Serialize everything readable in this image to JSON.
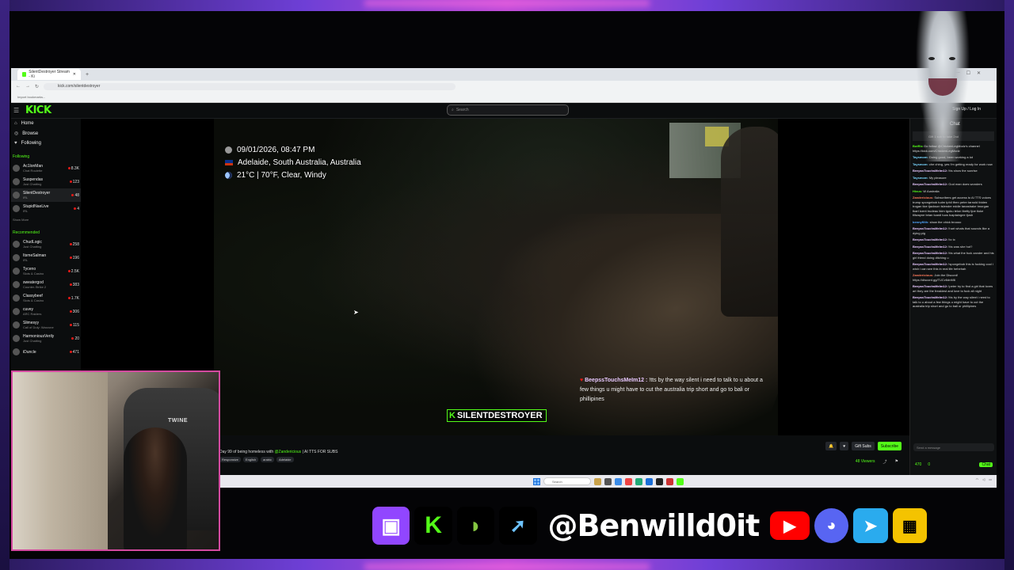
{
  "browser": {
    "tab_title": "SilentDestroyer Stream - Ki",
    "url": "kick.com/silentdestroyer",
    "bookmarks": "Import bookmarks..."
  },
  "kick": {
    "logo": "KICK",
    "search_placeholder": "Search",
    "login": "Sign Up / Log In",
    "nav": [
      {
        "label": "Home",
        "icon": "home-icon"
      },
      {
        "label": "Browse",
        "icon": "compass-icon"
      },
      {
        "label": "Following",
        "icon": "heart-icon"
      }
    ],
    "following_header": "Following",
    "following": [
      {
        "name": "Ac1lonMan",
        "sub": "Chat Roulette",
        "viewers": "8.3K"
      },
      {
        "name": "Suspendas",
        "sub": "Just Chatting",
        "viewers": "123"
      },
      {
        "name": "SilentDestroyer",
        "sub": "IRL",
        "viewers": "48"
      },
      {
        "name": "StupidNaeLive",
        "sub": "IRL",
        "viewers": "4"
      }
    ],
    "show_more": "Show More",
    "recommended_header": "Recommended",
    "recommended": [
      {
        "name": "ChudLogic",
        "sub": "Just Chatting",
        "viewers": "258"
      },
      {
        "name": "ItsmeSalman",
        "sub": "IRL",
        "viewers": "196"
      },
      {
        "name": "Tyceno",
        "sub": "Slots & Casino",
        "viewers": "2.5K"
      },
      {
        "name": "sweatergod",
        "sub": "Counter-Strike 2",
        "viewers": "383"
      },
      {
        "name": "Classybeef",
        "sub": "Slots & Casino",
        "viewers": "1.7K"
      },
      {
        "name": "cuvey",
        "sub": "ARC Raiders",
        "viewers": "306"
      },
      {
        "name": "Slimesyy",
        "sub": "Call of Duty: Warzone",
        "viewers": "115"
      },
      {
        "name": "HarmoniousVerily",
        "sub": "Just Chatting",
        "viewers": "20"
      },
      {
        "name": "iDuncle",
        "sub": "",
        "viewers": "471"
      }
    ]
  },
  "overlay": {
    "datetime": "09/01/2026, 08:47 PM",
    "location": "Adelaide, South Australia, Australia",
    "weather": "21°C | 70°F, Clear, Windy"
  },
  "tts": {
    "user": "BeepssTouchsMeIm12 :",
    "message": "!tts by the way silent i need to talk to u about a few things u might have to cut the australia trip short and go to bali or phillipines"
  },
  "watermark": "SILENTDESTROYER",
  "stream": {
    "title_prefix": "Day 99 of being homeless with",
    "title_mention": "@Zandericious",
    "title_suffix": "| AI TTS FOR SUBS",
    "tags": [
      "Responsive",
      "English",
      "arabic",
      "Adelaide"
    ],
    "gift_subs": "Gift Subs",
    "subscribe": "Subscribe",
    "viewers": "48 Viewers"
  },
  "chat": {
    "header": "Chat",
    "pinned": "Gift 1 sub to take 2nd",
    "messages": [
      {
        "user": "BotRix",
        "text": "Go follow @ChickenLegModz's channel https://kick.com/ChickenLegModz",
        "color": "#53fc18"
      },
      {
        "user": "Taysmom:",
        "text": "Doing good, been working a lot",
        "color": "#7ad7ff"
      },
      {
        "user": "Taysmom:",
        "text": "che ching, yes I'm getting ready for work now",
        "color": "#7ad7ff"
      },
      {
        "user": "BeepssTouchsMeIm12:",
        "text": "!tts show the sunrise",
        "color": "#e8c8ff"
      },
      {
        "user": "Taysmom:",
        "text": "My pleasure",
        "color": "#7ad7ff"
      },
      {
        "user": "BeepssTouchsMeIm12:",
        "text": "God man does wonders",
        "color": "#e8c8ff"
      },
      {
        "user": "Hixus:",
        "text": "W Australia",
        "color": "#53fc18"
      },
      {
        "user": "Zandericious:",
        "text": "Subscribers get access to AI TTS voices trump spongebob tudm tphil tfren peter tarnold tbiden trogan tice tjackson tslender eddie tanastrake tmorgan tkart tcent trudeau tkim tgoku telon tbetty tjoe tluke tlilwayne brian tcardi tuos tcaptaingee tjosh",
        "color": "#ff7b5c"
      },
      {
        "user": "bennyfilth:",
        "text": "show the chick broooo",
        "color": "#53a8ff"
      },
      {
        "user": "BeepssTouchsMeIm12:",
        "text": "!hart whats that sounds like a dying pig",
        "color": "#e8c8ff"
      },
      {
        "user": "BeepssTouchsMeIm12:",
        "text": "!tx tx",
        "color": "#e8c8ff"
      },
      {
        "user": "BeepssTouchsMeIm12:",
        "text": "!tts was she hot?",
        "color": "#e8c8ff"
      },
      {
        "user": "BeepssTouchsMeIm12:",
        "text": "!tts what the fuck zander and his girl friend doing ditching u",
        "color": "#e8c8ff"
      },
      {
        "user": "BeepssTouchsMeIm12:",
        "text": "!spongebob this is fucking cool i wish i can see this in real life hehehah",
        "color": "#e8c8ff"
      },
      {
        "user": "Zandericious:",
        "text": "Join the Discord! https://discord.gg/TUCv6dnM6",
        "color": "#ff7b5c"
      },
      {
        "user": "BeepssTouchsMeIm12:",
        "text": "!peter try to find a girl that loves art they are the freakiest and love to fuck all night",
        "color": "#e8c8ff"
      },
      {
        "user": "BeepssTouchsMeIm12:",
        "text": "!tts by the way silent i need to talk to u about a few things u might have to cut the australia trip short and go to bali or phillipines",
        "color": "#e8c8ff"
      }
    ],
    "input_placeholder": "Send a message",
    "points": "470",
    "count": "0",
    "send": "Chat"
  },
  "taskbar": {
    "search": "Search"
  },
  "webcam": {
    "chair_brand": "TWINE"
  },
  "socials": {
    "handle": "@Benwilld0it",
    "icons": [
      "twitch-icon",
      "kick-icon",
      "rumble-icon",
      "arrow-icon",
      "youtube-icon",
      "discord-icon",
      "telegram-icon",
      "bot-icon"
    ]
  }
}
